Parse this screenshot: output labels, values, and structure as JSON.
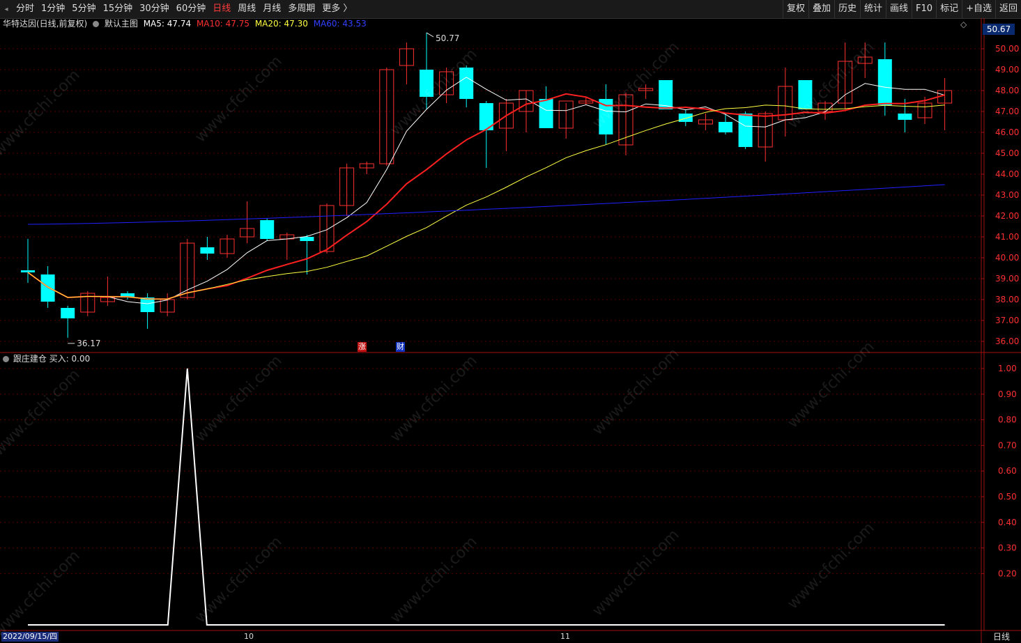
{
  "toolbar": {
    "tabs": [
      "分时",
      "1分钟",
      "5分钟",
      "15分钟",
      "30分钟",
      "60分钟",
      "日线",
      "周线",
      "月线",
      "多周期",
      "更多 〉"
    ],
    "active_tab": "日线",
    "tools": [
      "复权",
      "叠加",
      "历史",
      "统计",
      "画线",
      "F10",
      "标记",
      "+自选",
      "返回"
    ]
  },
  "main_panel": {
    "stock_name": "华特达因(日线,前复权)",
    "template": "默认主图",
    "ma5": "MA5: 47.74",
    "ma10": "MA10: 47.75",
    "ma20": "MA20: 47.30",
    "ma60": "MA60: 43.53",
    "current_price_tag": "50.67",
    "high_label": "50.77",
    "low_label": "36.17",
    "markers": [
      "涨",
      "财"
    ]
  },
  "sub_panel": {
    "indicator": "跟庄建仓",
    "value_label": "买入: 0.00"
  },
  "footer": {
    "date": "2022/09/15/四",
    "months": [
      "10",
      "11"
    ],
    "period": "日线"
  },
  "colors": {
    "up": "#ff3030",
    "down": "#00ffff",
    "ma5": "#ffffff",
    "ma10": "#ff2020",
    "ma20": "#ffff40",
    "ma60": "#2020ff",
    "grid": "#5a0000",
    "axis": "#a01010"
  },
  "watermark": "www.cfchi.com",
  "chart_data": [
    {
      "type": "candlestick",
      "price_axis": {
        "ticks": [
          36,
          37,
          38,
          39,
          40,
          41,
          42,
          43,
          44,
          45,
          46,
          47,
          48,
          49,
          50
        ],
        "range": [
          35.5,
          51.0
        ]
      },
      "candles": [
        {
          "o": 39.4,
          "h": 40.9,
          "l": 38.8,
          "c": 39.3
        },
        {
          "o": 39.2,
          "h": 39.6,
          "l": 37.6,
          "c": 37.9
        },
        {
          "o": 37.6,
          "h": 37.7,
          "l": 36.17,
          "c": 37.1
        },
        {
          "o": 37.4,
          "h": 38.4,
          "l": 37.2,
          "c": 38.3
        },
        {
          "o": 37.9,
          "h": 39.1,
          "l": 37.7,
          "c": 38.1
        },
        {
          "o": 38.3,
          "h": 38.4,
          "l": 38.0,
          "c": 38.1
        },
        {
          "o": 38.1,
          "h": 38.3,
          "l": 36.6,
          "c": 37.4
        },
        {
          "o": 37.4,
          "h": 38.3,
          "l": 37.2,
          "c": 38.0
        },
        {
          "o": 38.1,
          "h": 40.9,
          "l": 38.0,
          "c": 40.7
        },
        {
          "o": 40.5,
          "h": 41.0,
          "l": 39.9,
          "c": 40.2
        },
        {
          "o": 40.2,
          "h": 41.1,
          "l": 40.0,
          "c": 40.9
        },
        {
          "o": 41.0,
          "h": 42.7,
          "l": 40.7,
          "c": 41.4
        },
        {
          "o": 41.8,
          "h": 41.9,
          "l": 40.8,
          "c": 40.9
        },
        {
          "o": 40.9,
          "h": 41.2,
          "l": 39.9,
          "c": 41.1
        },
        {
          "o": 41.0,
          "h": 41.1,
          "l": 39.2,
          "c": 40.8
        },
        {
          "o": 40.3,
          "h": 42.6,
          "l": 40.2,
          "c": 42.5
        },
        {
          "o": 42.5,
          "h": 44.5,
          "l": 42.0,
          "c": 44.3
        },
        {
          "o": 44.3,
          "h": 44.6,
          "l": 44.0,
          "c": 44.5
        },
        {
          "o": 44.5,
          "h": 49.1,
          "l": 44.4,
          "c": 49.0
        },
        {
          "o": 49.2,
          "h": 50.3,
          "l": 48.3,
          "c": 50.0
        },
        {
          "o": 49.0,
          "h": 50.77,
          "l": 47.1,
          "c": 47.7
        },
        {
          "o": 47.8,
          "h": 49.1,
          "l": 47.4,
          "c": 48.9
        },
        {
          "o": 49.1,
          "h": 49.2,
          "l": 47.2,
          "c": 47.6
        },
        {
          "o": 47.4,
          "h": 47.5,
          "l": 44.3,
          "c": 46.1
        },
        {
          "o": 46.2,
          "h": 47.6,
          "l": 45.1,
          "c": 47.4
        },
        {
          "o": 47.0,
          "h": 48.0,
          "l": 46.0,
          "c": 48.0
        },
        {
          "o": 47.6,
          "h": 48.2,
          "l": 46.8,
          "c": 46.2
        },
        {
          "o": 46.2,
          "h": 47.4,
          "l": 45.7,
          "c": 47.5
        },
        {
          "o": 47.4,
          "h": 47.7,
          "l": 47.3,
          "c": 47.5
        },
        {
          "o": 47.6,
          "h": 48.3,
          "l": 45.4,
          "c": 45.9
        },
        {
          "o": 45.4,
          "h": 47.9,
          "l": 44.9,
          "c": 47.8
        },
        {
          "o": 48.0,
          "h": 48.3,
          "l": 47.6,
          "c": 48.1
        },
        {
          "o": 48.5,
          "h": 48.5,
          "l": 47.1,
          "c": 47.1
        },
        {
          "o": 46.9,
          "h": 47.1,
          "l": 46.3,
          "c": 46.5
        },
        {
          "o": 46.4,
          "h": 46.9,
          "l": 46.1,
          "c": 46.6
        },
        {
          "o": 46.5,
          "h": 46.9,
          "l": 45.9,
          "c": 46.0
        },
        {
          "o": 46.9,
          "h": 47.0,
          "l": 45.2,
          "c": 45.3
        },
        {
          "o": 45.3,
          "h": 47.0,
          "l": 44.6,
          "c": 46.9
        },
        {
          "o": 46.6,
          "h": 49.1,
          "l": 45.8,
          "c": 48.2
        },
        {
          "o": 48.5,
          "h": 48.5,
          "l": 47.1,
          "c": 47.1
        },
        {
          "o": 47.0,
          "h": 47.5,
          "l": 46.6,
          "c": 47.4
        },
        {
          "o": 47.4,
          "h": 50.3,
          "l": 47.1,
          "c": 49.4
        },
        {
          "o": 49.3,
          "h": 50.3,
          "l": 48.6,
          "c": 49.6
        },
        {
          "o": 49.5,
          "h": 50.3,
          "l": 46.8,
          "c": 47.3
        },
        {
          "o": 46.9,
          "h": 47.6,
          "l": 46.0,
          "c": 46.6
        },
        {
          "o": 46.7,
          "h": 47.7,
          "l": 46.4,
          "c": 47.4
        },
        {
          "o": 47.4,
          "h": 48.6,
          "l": 46.1,
          "c": 48.0
        }
      ],
      "ma60": [
        41.6,
        43.5
      ]
    },
    {
      "type": "line",
      "series": [
        {
          "name": "买入",
          "values": [
            0,
            0,
            0,
            0,
            0,
            0,
            0,
            0,
            1,
            0,
            0,
            0,
            0,
            0,
            0,
            0,
            0,
            0,
            0,
            0,
            0,
            0,
            0,
            0,
            0,
            0,
            0,
            0,
            0,
            0,
            0,
            0,
            0,
            0,
            0,
            0,
            0,
            0,
            0,
            0,
            0,
            0,
            0,
            0,
            0,
            0,
            0
          ]
        }
      ],
      "y_axis": {
        "ticks": [
          0.2,
          0.3,
          0.4,
          0.5,
          0.6,
          0.7,
          0.8,
          0.9,
          1.0
        ],
        "range": [
          0,
          1.05
        ]
      }
    }
  ]
}
